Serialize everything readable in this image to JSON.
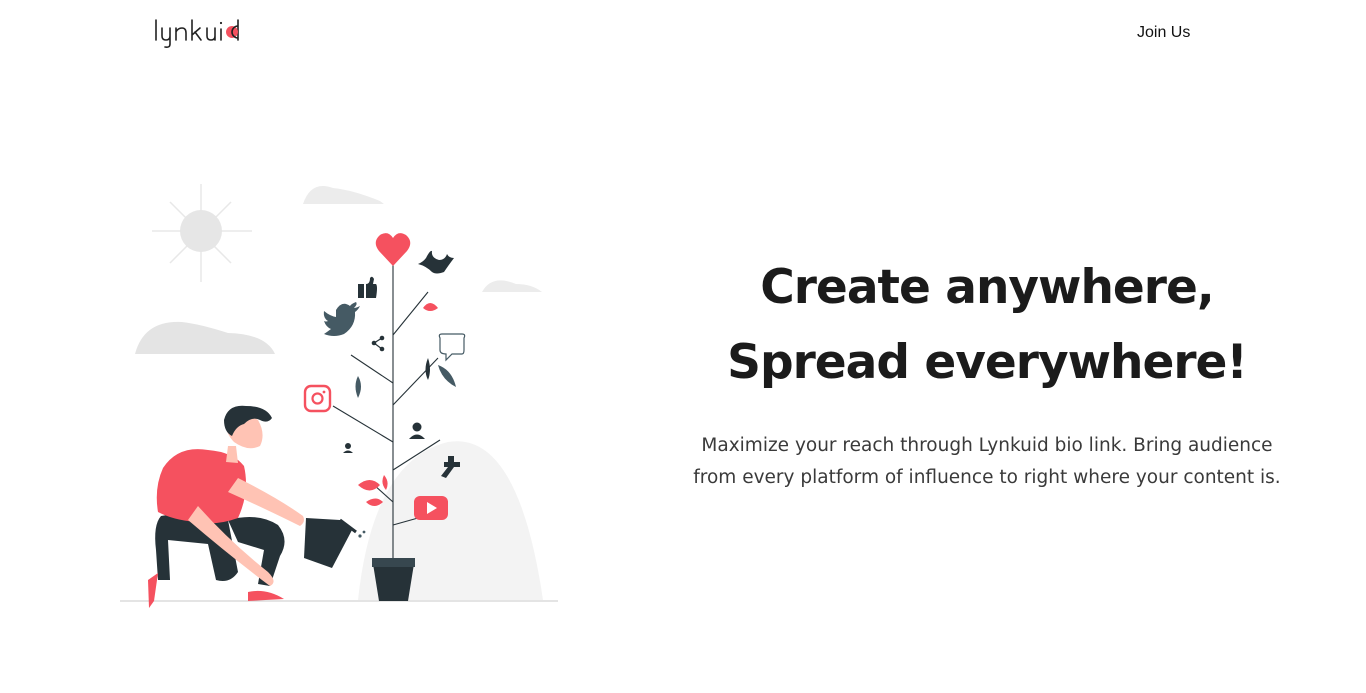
{
  "nav": {
    "logo_text": "lynkuid",
    "join_label": "Join Us"
  },
  "hero": {
    "headline": "Create anywhere, Spread everywhere!",
    "subtitle": "Maximize your reach through Lynkuid bio link. Bring audience from every platform of influence to right where your content is."
  },
  "colors": {
    "accent": "#f5515f",
    "dark": "#263238",
    "text": "#1b1b1b",
    "muted_gray": "#e6e6e6"
  },
  "illustration": {
    "icons": [
      "heart-icon",
      "snapchat-icon",
      "thumbs-up-icon",
      "twitter-icon",
      "share-icon",
      "chat-bubble-icon",
      "instagram-icon",
      "user-icon",
      "facebook-icon",
      "youtube-icon"
    ]
  }
}
